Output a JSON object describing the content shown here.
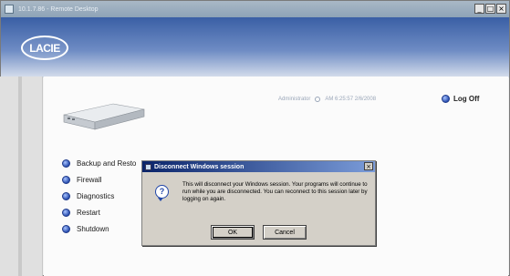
{
  "window": {
    "title": "10.1.7.86 - Remote Desktop",
    "controls": [
      "_",
      "□",
      "×"
    ]
  },
  "header": {
    "logo_text": "LACIE",
    "accent": "#3a5fa5"
  },
  "user_info": {
    "user": "Administrator",
    "timestamp": "AM 6:25:57 2/6/2008"
  },
  "logoff": {
    "label": "Log Off"
  },
  "menu": {
    "items": [
      {
        "label": "Backup and Resto"
      },
      {
        "label": "Firewall"
      },
      {
        "label": "Diagnostics"
      },
      {
        "label": "Restart"
      },
      {
        "label": "Shutdown"
      }
    ]
  },
  "dialog": {
    "title": "Disconnect Windows session",
    "message": "This will disconnect your Windows session. Your programs will continue to run while you are disconnected. You can reconnect to this session later by logging on again.",
    "ok_label": "OK",
    "cancel_label": "Cancel",
    "close_label": "×"
  }
}
